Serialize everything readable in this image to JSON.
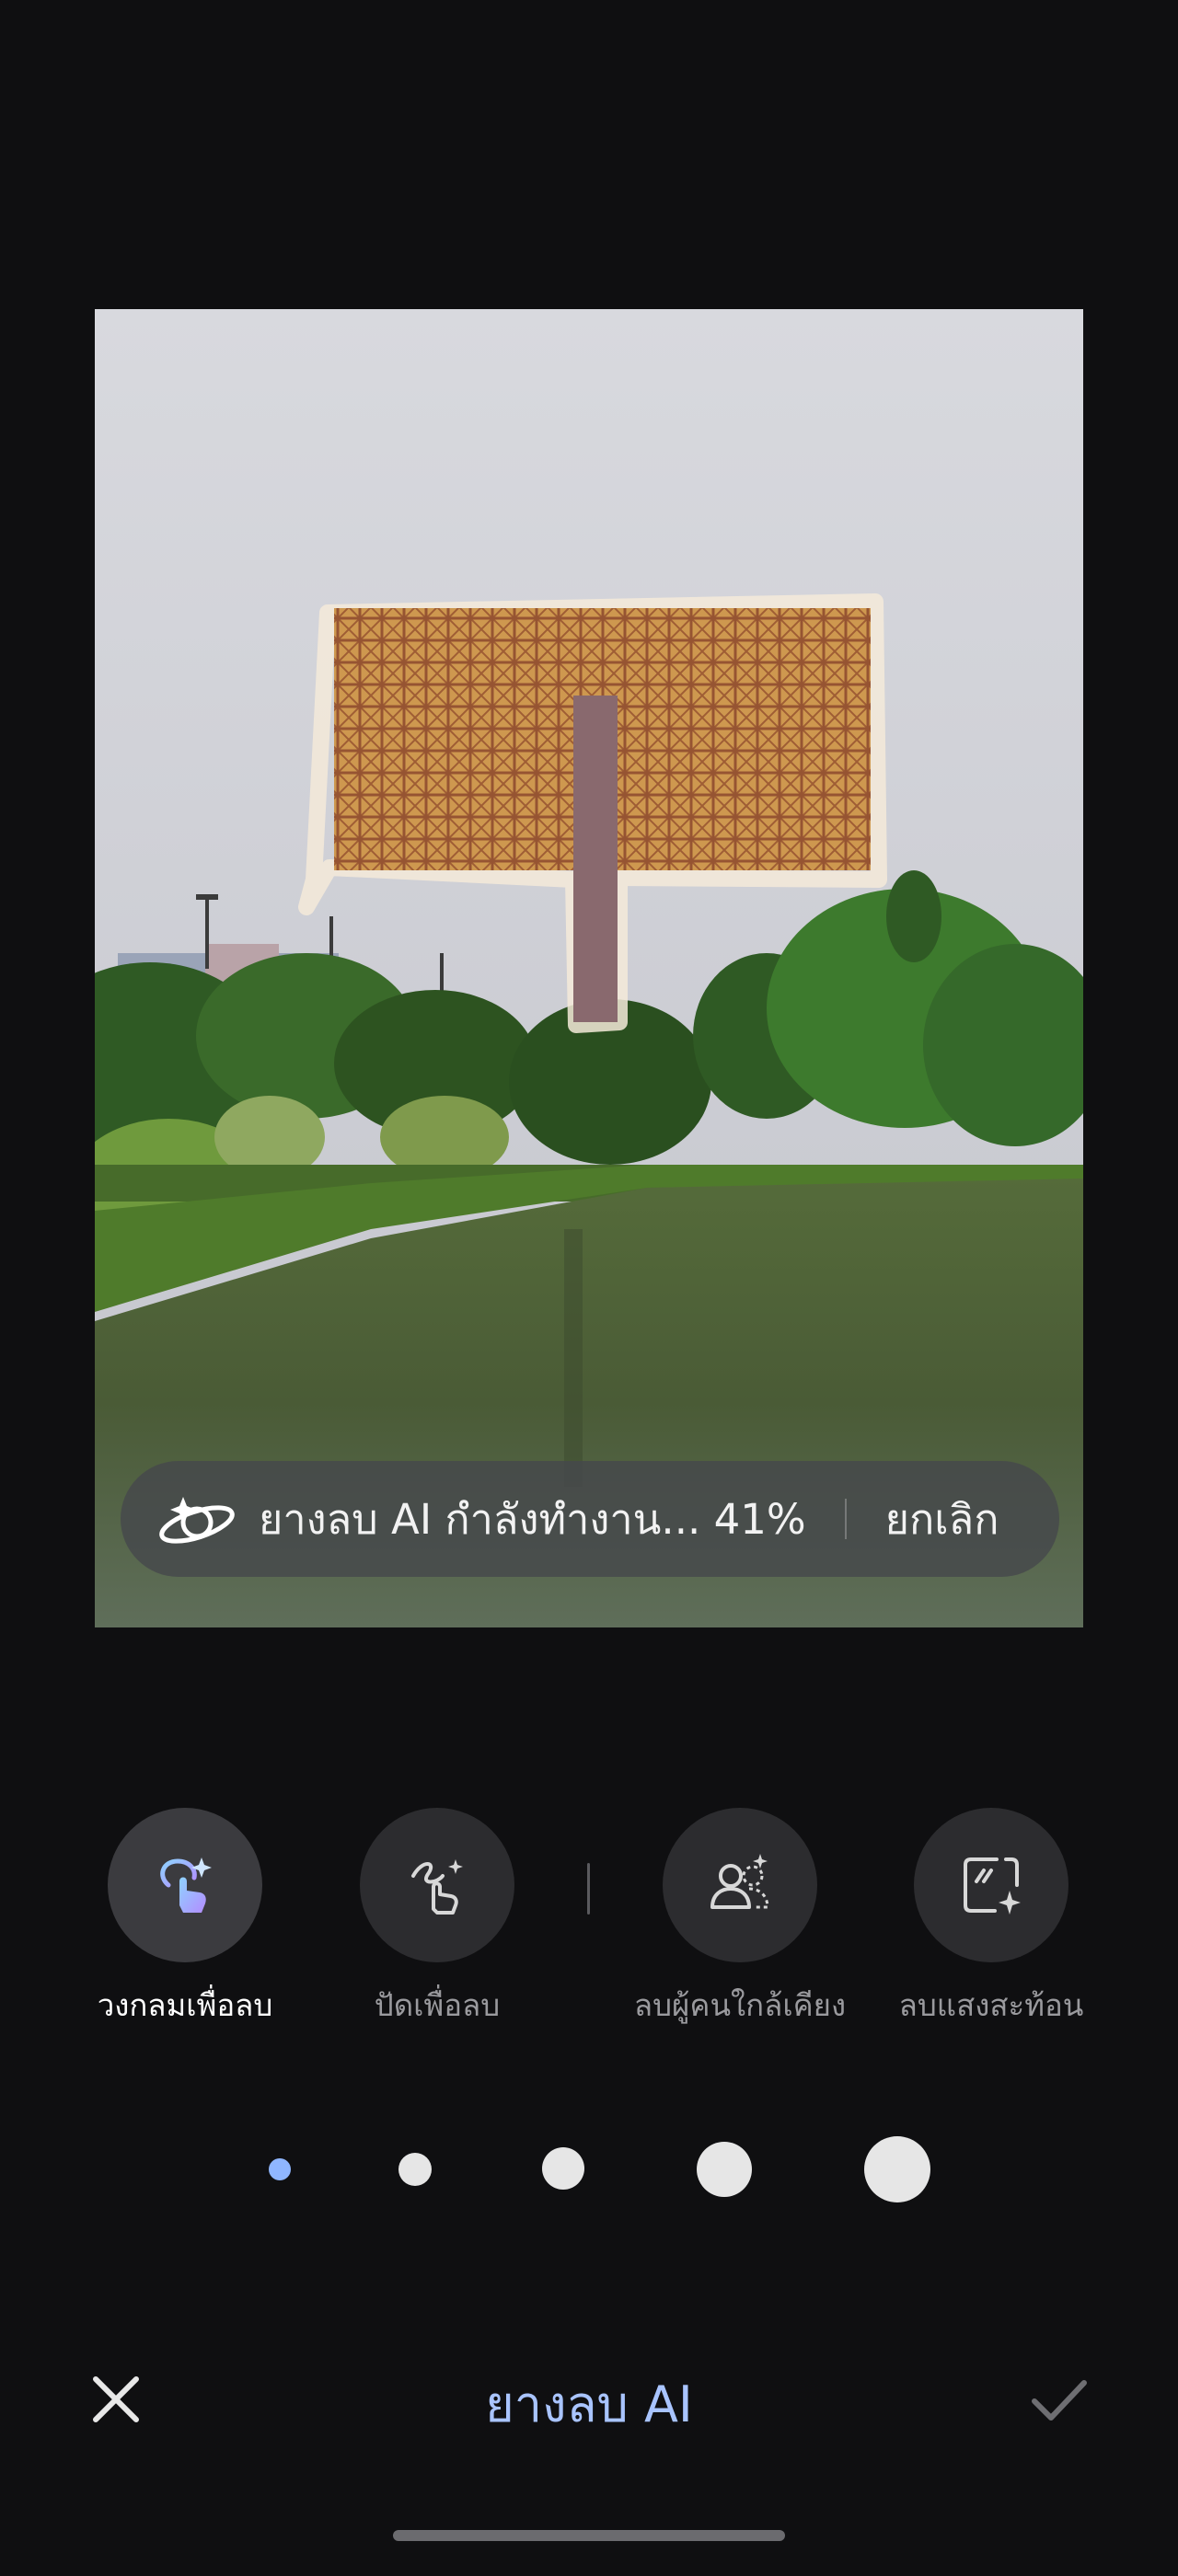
{
  "editor": {
    "progress_text": "ยางลบ AI กำลังทำงาน... 41%",
    "progress_percent": 41,
    "cancel_label": "ยกเลิก"
  },
  "tools": [
    {
      "label": "วงกลมเพื่อลบ",
      "icon": "circle-erase-icon",
      "active": true
    },
    {
      "label": "ปัดเพื่อลบ",
      "icon": "brush-erase-icon",
      "active": false
    },
    {
      "label": "ลบผู้คนใกล้เคียง",
      "icon": "remove-people-icon",
      "active": false
    },
    {
      "label": "ลบแสงสะท้อน",
      "icon": "remove-reflection-icon",
      "active": false
    }
  ],
  "brush_sizes": {
    "count": 5,
    "selected_index": 0,
    "selected_color": "#8fb6ff",
    "color": "#e6e6e6"
  },
  "bottom_bar": {
    "title": "ยางลบ AI",
    "close_icon": "close-icon",
    "confirm_icon": "check-icon"
  },
  "colors": {
    "background": "#0f0f11",
    "accent": "#a9c4ff",
    "selection_overlay": "#e0922e"
  }
}
